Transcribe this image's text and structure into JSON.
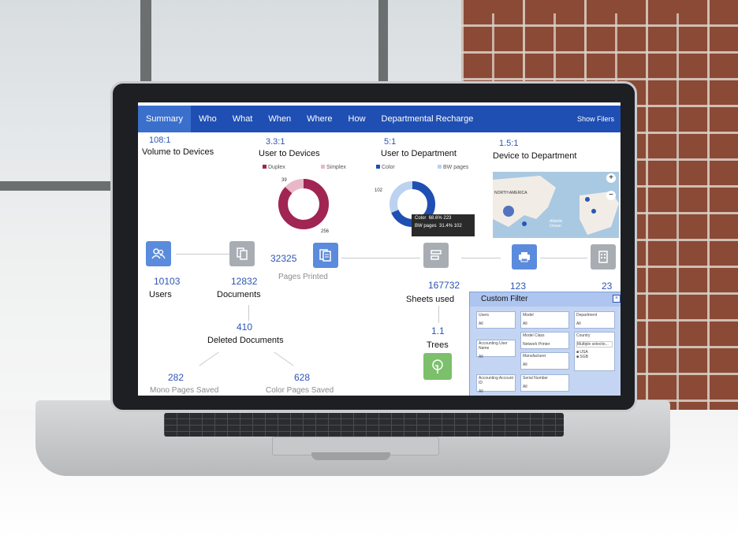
{
  "nav": {
    "tabs": [
      "Summary",
      "Who",
      "What",
      "When",
      "Where",
      "How",
      "Departmental Recharge"
    ],
    "active": "Summary",
    "show_filters": "Show Filers"
  },
  "metrics": [
    {
      "value": "108:1",
      "label": "Volume to Devices"
    },
    {
      "value": "3.3:1",
      "label": "User to Devices"
    },
    {
      "value": "5:1",
      "label": "User to Department"
    },
    {
      "value": "1.5:1",
      "label": "Device to Department"
    }
  ],
  "chart_data": [
    {
      "type": "pie",
      "title": "",
      "categories": [
        "Duplex",
        "Simplex"
      ],
      "values": [
        256,
        39
      ],
      "colors": [
        "#a02553",
        "#e9b8c8"
      ],
      "labels": [
        "39",
        "256"
      ]
    },
    {
      "type": "pie",
      "title": "",
      "categories": [
        "Color",
        "BW pages"
      ],
      "values": [
        223,
        102
      ],
      "colors": [
        "#1f4fb3",
        "#bcd2f0"
      ],
      "labels": [
        "102"
      ],
      "tooltip": {
        "rows": [
          {
            "name": "Color",
            "pct": "68.6%",
            "value": "223"
          },
          {
            "name": "BW pages",
            "pct": "31.4%",
            "value": "102"
          }
        ]
      }
    }
  ],
  "legends": {
    "duplex": "Duplex",
    "simplex": "Simplex",
    "color": "Color",
    "bw": "BW pages"
  },
  "map": {
    "label_na": "NORTH AMERICA",
    "label_ocean": "Atlantic Ocean"
  },
  "flow": {
    "users": {
      "value": "10103",
      "label": "Users"
    },
    "documents": {
      "value": "12832",
      "label": "Documents"
    },
    "pages_printed": {
      "value": "32325",
      "label": "Pages Printed"
    },
    "sheets": {
      "value": "167732",
      "label": "Sheets used"
    },
    "devices": {
      "value": "123"
    },
    "departments": {
      "value": "23"
    },
    "deleted": {
      "value": "410",
      "label": "Deleted Documents"
    },
    "mono": {
      "value": "282",
      "label": "Mono Pages Saved"
    },
    "color": {
      "value": "628",
      "label": "Color Pages Saved"
    },
    "trees": {
      "value": "1.1",
      "label": "Trees"
    }
  },
  "filter": {
    "title": "Custom Filter",
    "fields": [
      "Users",
      "Model",
      "Department",
      "Model Class",
      "Country",
      "Accounting User Name",
      "Manufacturer",
      "Accounting Account ID",
      "Serial Number"
    ],
    "values": [
      "All",
      "All",
      "All",
      "Network Printer",
      "Multiple selectio...",
      "All",
      "All",
      "All",
      "All"
    ],
    "country_options": [
      "USA",
      "SGB"
    ]
  }
}
